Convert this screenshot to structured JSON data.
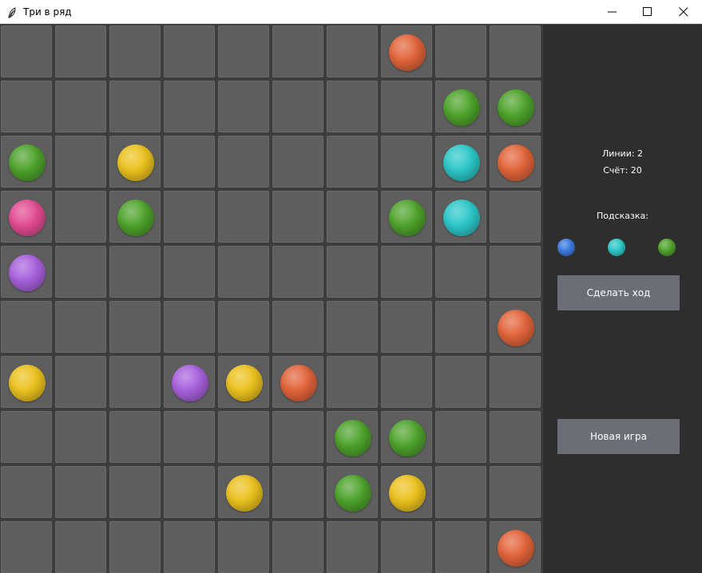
{
  "window": {
    "title": "Три в ряд",
    "icon": "feather-icon",
    "controls": [
      "minimize-icon",
      "maximize-icon",
      "close-icon"
    ]
  },
  "board": {
    "rows": 10,
    "cols": 10,
    "colors": {
      "cell": "#5e5e5e",
      "background": "#3d3d3d"
    },
    "ball_colors": {
      "orange": "#e2643a",
      "green": "#4ea32b",
      "yellow": "#ecc21e",
      "cyan": "#2cc7c9",
      "pink": "#e24b91",
      "purple": "#a860dc",
      "blue": "#3a7ae0"
    },
    "balls": [
      {
        "row": 0,
        "col": 7,
        "color": "orange"
      },
      {
        "row": 1,
        "col": 8,
        "color": "green"
      },
      {
        "row": 1,
        "col": 9,
        "color": "green"
      },
      {
        "row": 2,
        "col": 0,
        "color": "green"
      },
      {
        "row": 2,
        "col": 2,
        "color": "yellow"
      },
      {
        "row": 2,
        "col": 8,
        "color": "cyan"
      },
      {
        "row": 2,
        "col": 9,
        "color": "orange"
      },
      {
        "row": 3,
        "col": 0,
        "color": "pink"
      },
      {
        "row": 3,
        "col": 2,
        "color": "green"
      },
      {
        "row": 3,
        "col": 7,
        "color": "green"
      },
      {
        "row": 3,
        "col": 8,
        "color": "cyan"
      },
      {
        "row": 4,
        "col": 0,
        "color": "purple"
      },
      {
        "row": 5,
        "col": 9,
        "color": "orange"
      },
      {
        "row": 6,
        "col": 0,
        "color": "yellow"
      },
      {
        "row": 6,
        "col": 3,
        "color": "purple"
      },
      {
        "row": 6,
        "col": 4,
        "color": "yellow"
      },
      {
        "row": 6,
        "col": 5,
        "color": "orange"
      },
      {
        "row": 7,
        "col": 6,
        "color": "green"
      },
      {
        "row": 7,
        "col": 7,
        "color": "green"
      },
      {
        "row": 8,
        "col": 4,
        "color": "yellow"
      },
      {
        "row": 8,
        "col": 6,
        "color": "green"
      },
      {
        "row": 8,
        "col": 7,
        "color": "yellow"
      },
      {
        "row": 9,
        "col": 9,
        "color": "orange"
      }
    ]
  },
  "panel": {
    "lines_text": "Линии: 2",
    "score_text": "Счёт: 20",
    "hint_title": "Подсказка:",
    "hint_balls": [
      "blue",
      "cyan",
      "green"
    ],
    "make_move_label": "Сделать ход",
    "new_game_label": "Новая игра",
    "colors": {
      "background": "#2e2e2e",
      "button": "#6b6e76"
    }
  }
}
